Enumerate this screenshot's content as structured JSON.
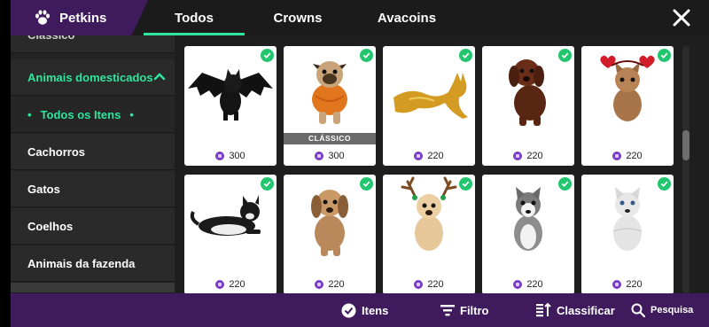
{
  "header": {
    "brand": "Petkins",
    "tabs": [
      "Todos",
      "Crowns",
      "Avacoins"
    ]
  },
  "sidebar": {
    "partial_item": "Clássico",
    "items": [
      {
        "label": "Animais domesticados"
      },
      {
        "label": "Todos os Itens"
      },
      {
        "label": "Cachorros"
      },
      {
        "label": "Gatos"
      },
      {
        "label": "Coelhos"
      },
      {
        "label": "Animais da fazenda"
      }
    ]
  },
  "items": [
    {
      "price": "300",
      "icon": "black-bat-cat"
    },
    {
      "price": "300",
      "icon": "pug-pumpkin-costume",
      "badge": "CLÁSSICO"
    },
    {
      "price": "220",
      "icon": "golden-cat-statue"
    },
    {
      "price": "220",
      "icon": "brown-puppy"
    },
    {
      "price": "220",
      "icon": "kitten-heart-headband"
    },
    {
      "price": "220",
      "icon": "lying-tuxedo-cat"
    },
    {
      "price": "220",
      "icon": "tan-puppy"
    },
    {
      "price": "220",
      "icon": "puppy-reindeer-antlers"
    },
    {
      "price": "220",
      "icon": "husky-puppy"
    },
    {
      "price": "220",
      "icon": "white-husky-puppy"
    }
  ],
  "bottombar": {
    "itens": "Itens",
    "filtro": "Filtro",
    "classificar": "Classificar",
    "pesquisa": "Pesquisa"
  },
  "colors": {
    "accent": "#2ee59d",
    "brand_purple": "#3f1b5e",
    "check_green": "#21c76f",
    "coin_purple": "#7a3cc6"
  }
}
